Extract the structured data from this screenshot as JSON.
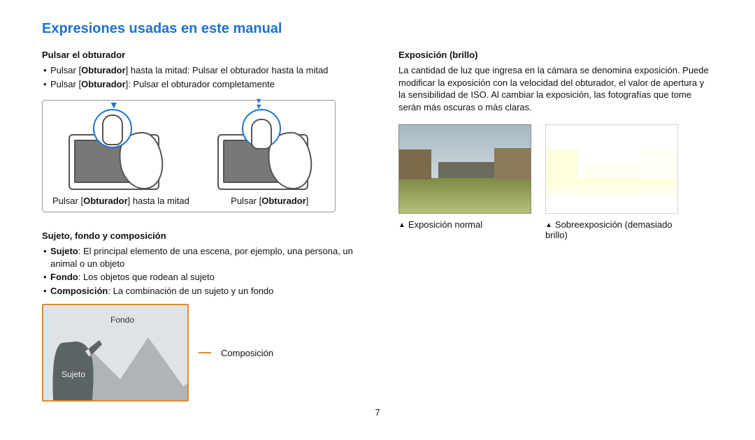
{
  "title": "Expresiones usadas en este manual",
  "page_number": "7",
  "left": {
    "shutter": {
      "heading": "Pulsar el obturador",
      "bullets": [
        {
          "pre": "Pulsar [",
          "bold": "Obturador",
          "post": "] hasta la mitad: Pulsar el obturador hasta la mitad"
        },
        {
          "pre": "Pulsar [",
          "bold": "Obturador",
          "post": "]: Pulsar el obturador completamente"
        }
      ],
      "fig1_pre": "Pulsar [",
      "fig1_bold": "Obturador",
      "fig1_post": "] hasta la mitad",
      "fig2_pre": "Pulsar [",
      "fig2_bold": "Obturador",
      "fig2_post": "]"
    },
    "subject": {
      "heading": "Sujeto, fondo y composición",
      "bullets": [
        {
          "bold": "Sujeto",
          "rest": ": El principal elemento de una escena, por ejemplo, una persona, un animal o un objeto"
        },
        {
          "bold": "Fondo",
          "rest": ": Los objetos que rodean al sujeto"
        },
        {
          "bold": "Composición",
          "rest": ": La combinación de un sujeto y un fondo"
        }
      ],
      "label_fondo": "Fondo",
      "label_sujeto": "Sujeto",
      "label_composicion": "Composición"
    }
  },
  "right": {
    "exposure": {
      "heading": "Exposición (brillo)",
      "paragraph": "La cantidad de luz que ingresa en la cámara se denomina exposición. Puede modificar la exposición con la velocidad del obturador, el valor de apertura y la sensibilidad de ISO. Al cambiar la exposición, las fotografías que tome serán más oscuras o más claras.",
      "cap_normal": "Exposición normal",
      "cap_over": "Sobreexposición (demasiado brillo)"
    }
  }
}
